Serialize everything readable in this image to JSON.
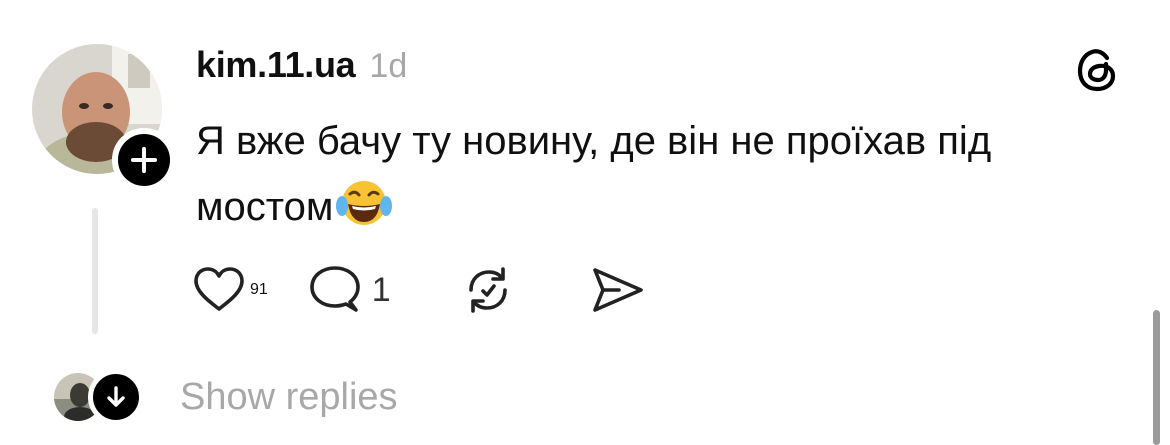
{
  "post": {
    "username": "kim.11.ua",
    "timestamp": "1d",
    "text": "Я вже бачу ту новину, де він не проїхав під мостом",
    "emoji": "face-with-tears-of-joy"
  },
  "actions": {
    "likes": "91",
    "replies": "1"
  },
  "thread": {
    "show_replies_label": "Show replies"
  },
  "icons": {
    "avatar": "profile-photo",
    "follow": "plus-icon",
    "brand": "threads-logo-icon",
    "like": "heart-icon",
    "reply": "comment-bubble-icon",
    "repost": "repost-icon",
    "share": "send-icon",
    "expand": "arrow-down-icon"
  },
  "colors": {
    "text": "#101010",
    "muted": "#a8a8a8",
    "thread_line": "#e6e6e6",
    "badge": "#000000"
  }
}
